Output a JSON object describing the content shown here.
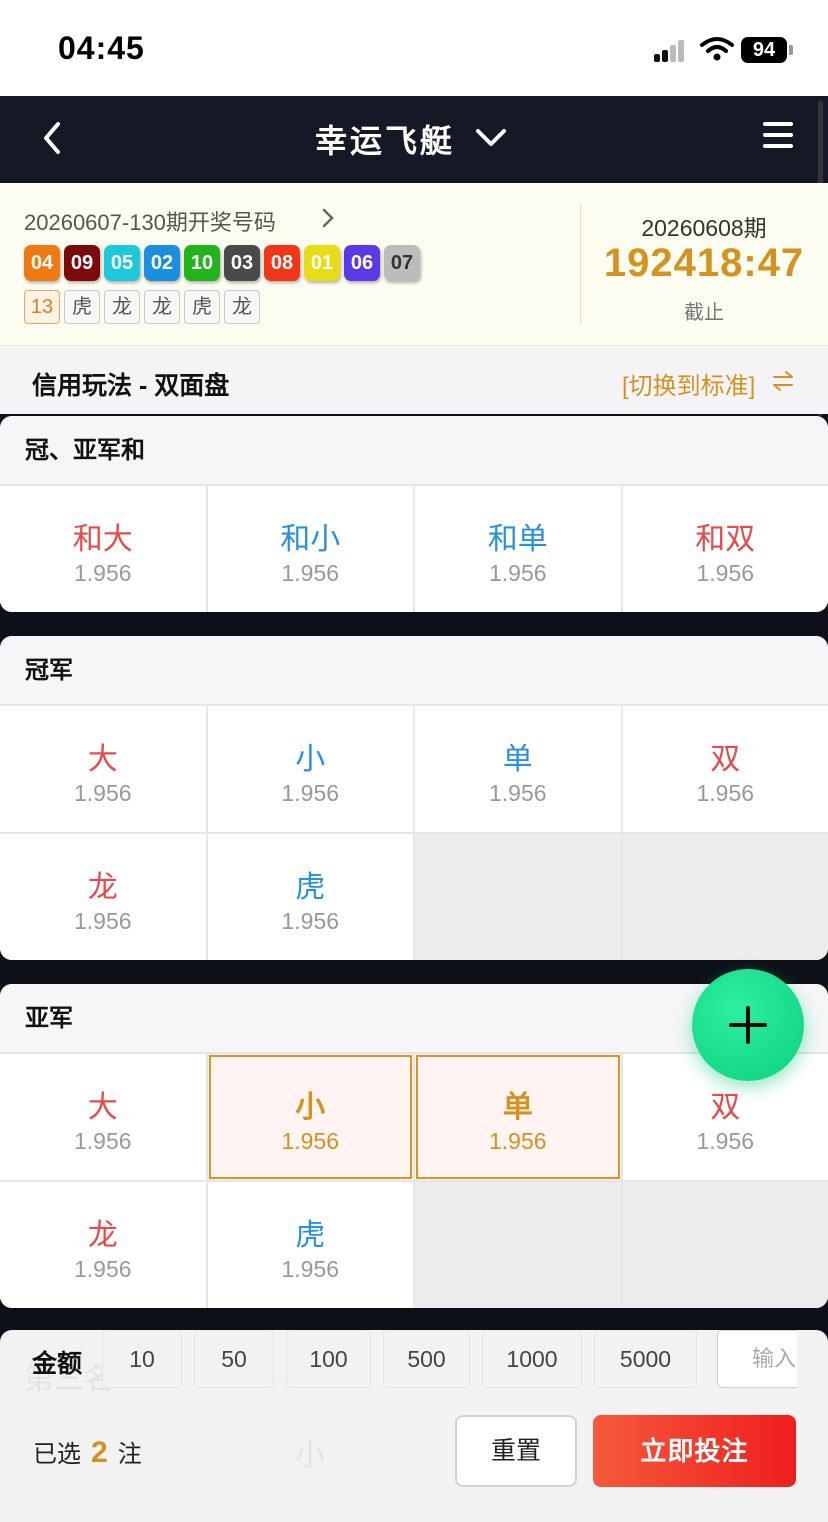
{
  "status_bar": {
    "time": "04:45",
    "battery": "94"
  },
  "nav": {
    "title": "幸运飞艇"
  },
  "draw": {
    "last_period": "20260607-130期开奖号码",
    "balls": [
      {
        "num": "04",
        "color": "#f07a12"
      },
      {
        "num": "09",
        "color": "#7d0a0a"
      },
      {
        "num": "05",
        "color": "#1ec8d8"
      },
      {
        "num": "02",
        "color": "#1a8fe0"
      },
      {
        "num": "10",
        "color": "#23b31c"
      },
      {
        "num": "03",
        "color": "#4a4a4a"
      },
      {
        "num": "08",
        "color": "#f2361a"
      },
      {
        "num": "01",
        "color": "#e8dc16"
      },
      {
        "num": "06",
        "color": "#5a3ae6"
      },
      {
        "num": "07",
        "color": "#bcbcbc"
      }
    ],
    "tags": [
      "13",
      "虎",
      "龙",
      "龙",
      "虎",
      "龙"
    ],
    "next_period": "20260608期",
    "countdown": "192418:47",
    "deadline_label": "截止"
  },
  "mode": {
    "title": "信用玩法 - 双面盘",
    "switch_label": "[切换到标准]"
  },
  "sections": [
    {
      "title": "冠、亚军和",
      "cells": [
        {
          "name": "和大",
          "odds": "1.956",
          "color": "red"
        },
        {
          "name": "和小",
          "odds": "1.956",
          "color": "blue"
        },
        {
          "name": "和单",
          "odds": "1.956",
          "color": "blue"
        },
        {
          "name": "和双",
          "odds": "1.956",
          "color": "red"
        }
      ]
    },
    {
      "title": "冠军",
      "cells": [
        {
          "name": "大",
          "odds": "1.956",
          "color": "red"
        },
        {
          "name": "小",
          "odds": "1.956",
          "color": "blue"
        },
        {
          "name": "单",
          "odds": "1.956",
          "color": "blue"
        },
        {
          "name": "双",
          "odds": "1.956",
          "color": "red"
        },
        {
          "name": "龙",
          "odds": "1.956",
          "color": "red"
        },
        {
          "name": "虎",
          "odds": "1.956",
          "color": "blue"
        }
      ]
    },
    {
      "title": "亚军",
      "cells": [
        {
          "name": "大",
          "odds": "1.956",
          "color": "red"
        },
        {
          "name": "小",
          "odds": "1.956",
          "color": "blue",
          "selected": true
        },
        {
          "name": "单",
          "odds": "1.956",
          "color": "blue",
          "selected": true
        },
        {
          "name": "双",
          "odds": "1.956",
          "color": "red"
        },
        {
          "name": "龙",
          "odds": "1.956",
          "color": "red"
        },
        {
          "name": "虎",
          "odds": "1.956",
          "color": "blue"
        }
      ]
    }
  ],
  "bet_bar": {
    "amount_label": "金额",
    "chips": [
      "10",
      "50",
      "100",
      "500",
      "1000",
      "5000"
    ],
    "input_placeholder": "输入",
    "selected_prefix": "已选",
    "selected_count": "2",
    "selected_suffix": "注",
    "reset_label": "重置",
    "bet_label": "立即投注"
  },
  "colors": {
    "accent_gold": "#d49221",
    "red": "#e84a4a",
    "blue": "#2791e0",
    "fab": "#12d98a"
  }
}
